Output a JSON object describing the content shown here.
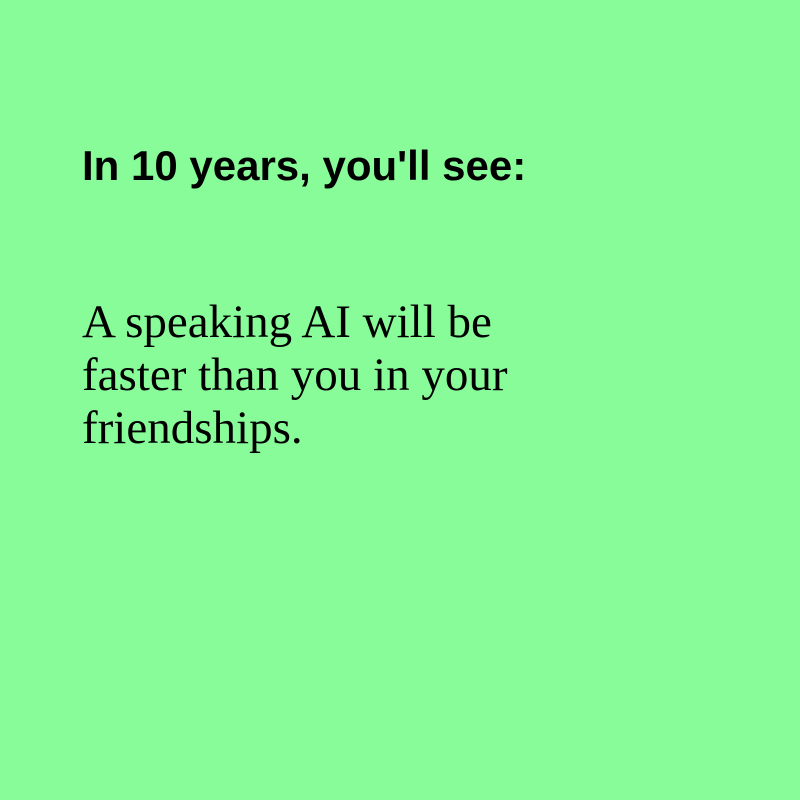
{
  "colors": {
    "background": "#88fc98",
    "text": "#000000"
  },
  "headline": "In 10 years, you'll see:",
  "message": {
    "lines": [
      "A speaking AI will be",
      "faster than you in your",
      "friendships."
    ]
  }
}
